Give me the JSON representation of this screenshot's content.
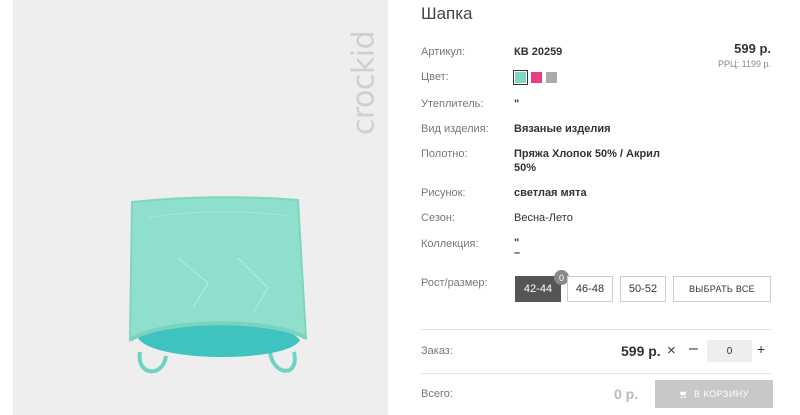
{
  "product": {
    "title": "Шапка",
    "brand": "crockid",
    "price": "599 р.",
    "rrc": "РРЦ: 1199 р."
  },
  "specs": [
    {
      "label": "Артикул:",
      "value": "КВ 20259"
    },
    {
      "label": "Цвет:",
      "value": ""
    },
    {
      "label": "Утеплитель:",
      "value": "\""
    },
    {
      "label": "Вид изделия:",
      "value": "Вязаные изделия"
    },
    {
      "label": "Полотно:",
      "value_line1": "Пряжа Хлопок 50% / Акрил",
      "value_line2": "50%"
    },
    {
      "label": "Рисунок:",
      "value": "светлая мята"
    },
    {
      "label": "Сезон:",
      "value": "Весна-Лето"
    },
    {
      "label": "Коллекция:",
      "value_line1": "\"",
      "value_line2": "–"
    }
  ],
  "colors": [
    "#7fd6c4",
    "#e83d84",
    "#aaaaaa"
  ],
  "sizes": {
    "label": "Рост/размер:",
    "options": [
      "42-44",
      "46-48",
      "50-52"
    ],
    "selected": "42-44",
    "badge": "0",
    "select_all": "ВЫБРАТЬ ВСЕ"
  },
  "order": {
    "label": "Заказ:",
    "price": "599 р.",
    "times": "×",
    "minus": "–",
    "qty": "0",
    "plus": "+"
  },
  "total": {
    "label": "Всего:",
    "price": "0 р.",
    "cart_button": "В КОРЗИНУ"
  }
}
